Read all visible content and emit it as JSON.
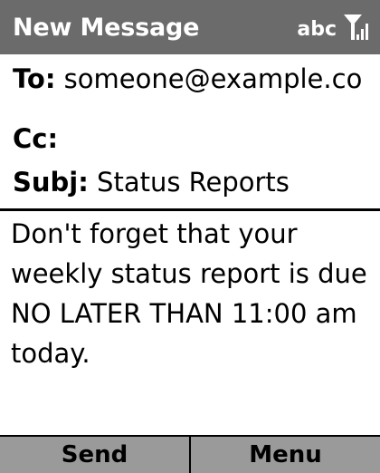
{
  "title_bar": {
    "title": "New Message",
    "input_mode": "abc",
    "signal_icon": "signal-strength-icon"
  },
  "header": {
    "to_label": "To:",
    "to_value": "someone@example.co",
    "cc_label": "Cc:",
    "cc_value": "",
    "subject_label": "Subj:",
    "subject_value": "Status Reports"
  },
  "body": {
    "lines": [
      "Don't forget that your",
      "weekly status report is due",
      "NO LATER THAN 11:00 am",
      "today."
    ]
  },
  "softkeys": {
    "left_label": "Send",
    "right_label": "Menu"
  },
  "colors": {
    "title_bar": "#6b6b6b",
    "softkey_bar": "#9a9a9a",
    "text": "#000000"
  }
}
